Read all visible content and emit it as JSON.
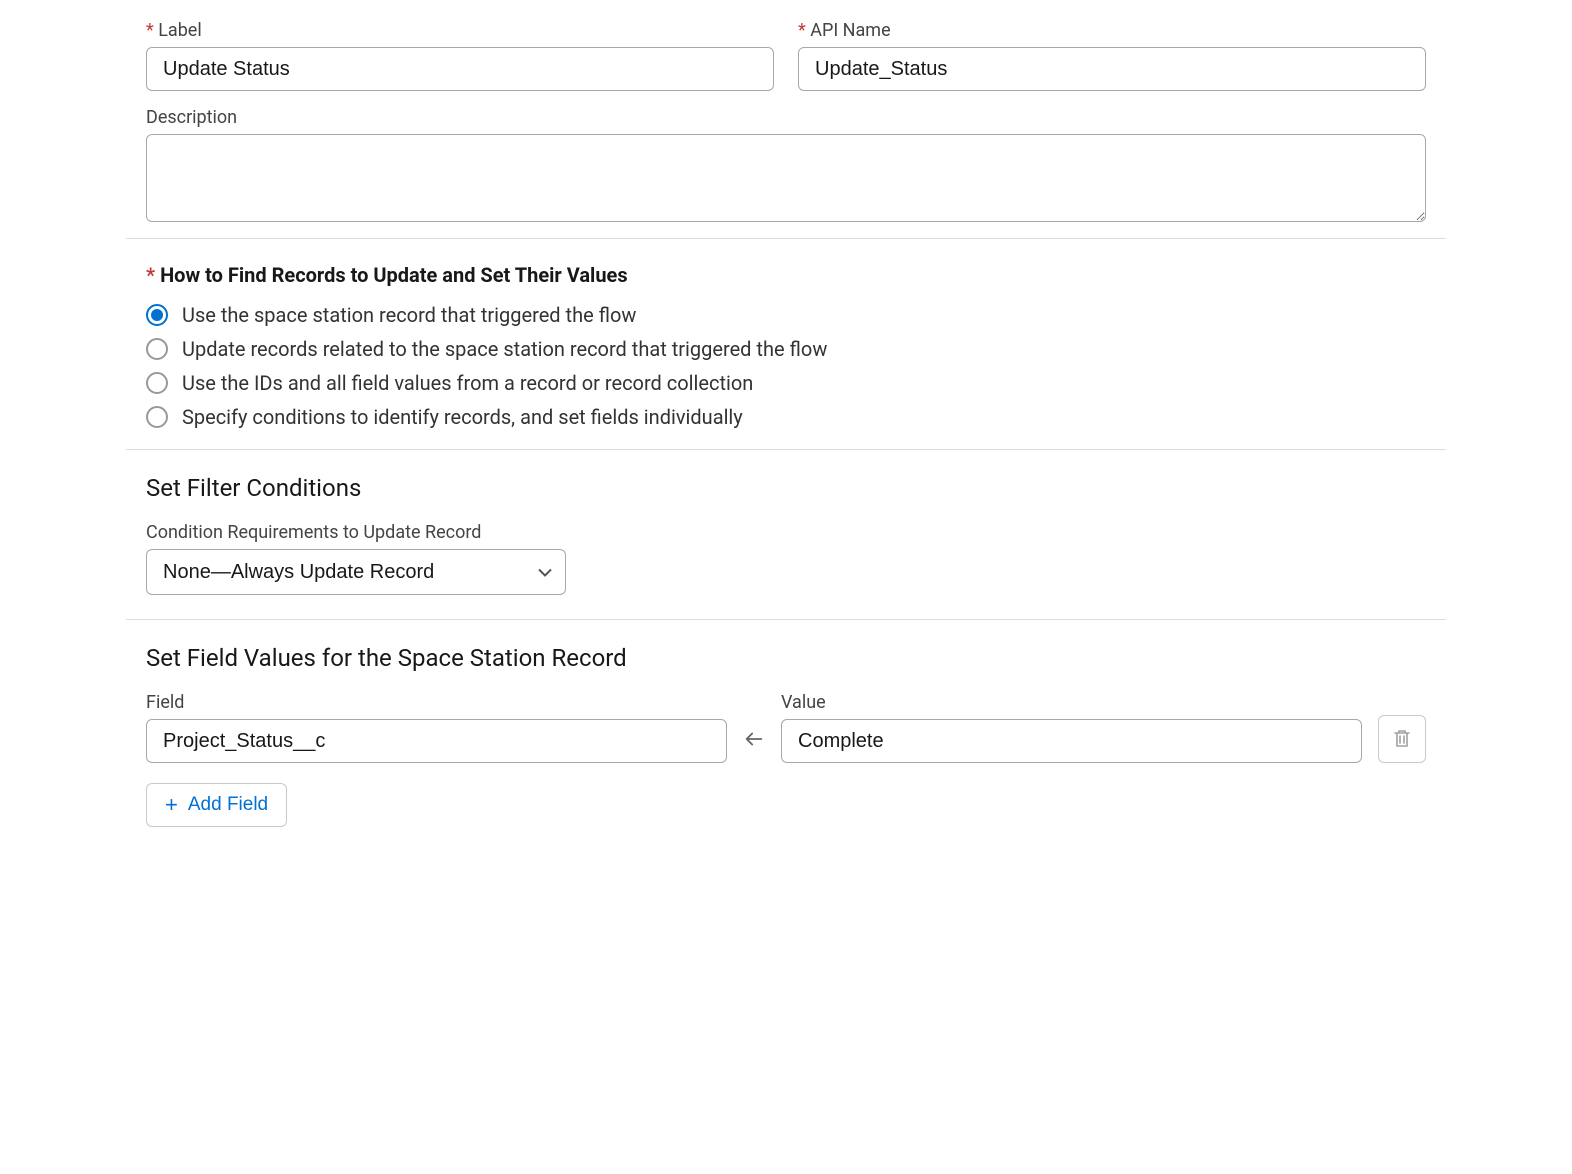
{
  "labels": {
    "label_field": "Label",
    "api_name_field": "API Name",
    "description_field": "Description"
  },
  "values": {
    "label": "Update Status",
    "api_name": "Update_Status",
    "description": ""
  },
  "how_to_find": {
    "heading": "How to Find Records to Update and Set Their Values",
    "options": [
      {
        "label": "Use the space station record that triggered the flow",
        "checked": true
      },
      {
        "label": "Update records related to the space station record that triggered the flow",
        "checked": false
      },
      {
        "label": "Use the IDs and all field values from a record or record collection",
        "checked": false
      },
      {
        "label": "Specify conditions to identify records, and set fields individually",
        "checked": false
      }
    ]
  },
  "filter": {
    "section_title": "Set Filter Conditions",
    "sub_label": "Condition Requirements to Update Record",
    "selected": "None—Always Update Record"
  },
  "field_values": {
    "section_title": "Set Field Values for the Space Station Record",
    "field_label": "Field",
    "value_label": "Value",
    "rows": [
      {
        "field": "Project_Status__c",
        "value": "Complete"
      }
    ],
    "add_button": "Add Field"
  }
}
